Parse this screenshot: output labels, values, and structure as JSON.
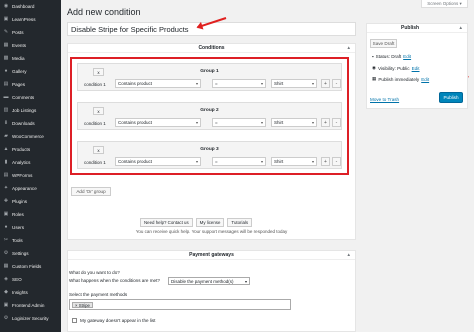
{
  "screen_options": "Screen Options ▾",
  "page_title": "Add new condition",
  "title_value": "Disable Stripe for Specific Products",
  "sidebar": {
    "items": [
      {
        "label": "Dashboard",
        "icon": "dashboard-icon",
        "glyph": "◉"
      },
      {
        "label": "LearnPress",
        "icon": "learnpress-icon",
        "glyph": "▣"
      },
      {
        "label": "Posts",
        "icon": "posts-icon",
        "glyph": "✎"
      },
      {
        "label": "Events",
        "icon": "events-icon",
        "glyph": "▦"
      },
      {
        "label": "Media",
        "icon": "media-icon",
        "glyph": "▩"
      },
      {
        "label": "Gallery",
        "icon": "gallery-icon",
        "glyph": "●"
      },
      {
        "label": "Pages",
        "icon": "pages-icon",
        "glyph": "▤"
      },
      {
        "label": "Comments",
        "icon": "comments-icon",
        "glyph": "▬"
      },
      {
        "label": "Job Listings",
        "icon": "job-listings-icon",
        "glyph": "▥"
      },
      {
        "label": "Downloads",
        "icon": "downloads-icon",
        "glyph": "⬇"
      },
      {
        "label": "WooCommerce",
        "icon": "woocommerce-icon",
        "glyph": "▰"
      },
      {
        "label": "Products",
        "icon": "products-icon",
        "glyph": "▲"
      },
      {
        "label": "Analytics",
        "icon": "analytics-icon",
        "glyph": "▮"
      },
      {
        "label": "WPForms",
        "icon": "wpforms-icon",
        "glyph": "▤"
      },
      {
        "label": "Appearance",
        "icon": "appearance-icon",
        "glyph": "✦"
      },
      {
        "label": "Plugins",
        "icon": "plugins-icon",
        "glyph": "✚"
      },
      {
        "label": "Roles",
        "icon": "roles-icon",
        "glyph": "▣"
      },
      {
        "label": "Users",
        "icon": "users-icon",
        "glyph": "●"
      },
      {
        "label": "Tools",
        "icon": "tools-icon",
        "glyph": "✂"
      },
      {
        "label": "Settings",
        "icon": "settings-icon",
        "glyph": "⚙"
      },
      {
        "label": "Custom Fields",
        "icon": "custom-fields-icon",
        "glyph": "▦"
      },
      {
        "label": "SEO",
        "icon": "seo-icon",
        "glyph": "◈"
      },
      {
        "label": "Insights",
        "icon": "insights-icon",
        "glyph": "◆"
      },
      {
        "label": "Frontend Admin",
        "icon": "frontend-admin-icon",
        "glyph": "▣"
      },
      {
        "label": "Loginizer Security",
        "icon": "loginizer-icon",
        "glyph": "⚙"
      }
    ]
  },
  "conditions_box": {
    "title": "Conditions",
    "toggle": "▲",
    "groups": [
      {
        "remove": "x",
        "title": "Group 1",
        "condition_label": "condition 1",
        "field": "Contains product",
        "operator": "=",
        "value": "Shirt",
        "add": "+",
        "minus": "-"
      },
      {
        "remove": "x",
        "title": "Group 2",
        "condition_label": "condition 1",
        "field": "Contains product",
        "operator": "=",
        "value": "Shirt",
        "add": "+",
        "minus": "-"
      },
      {
        "remove": "x",
        "title": "Group 3",
        "condition_label": "condition 1",
        "field": "Contains product",
        "operator": "=",
        "value": "Shirt",
        "add": "+",
        "minus": "-"
      }
    ],
    "add_or_group": "Add 'Or' group",
    "help_links": [
      "Need help? Contact us",
      "My license",
      "Tutorials"
    ],
    "help_text": "You can receive quick help. Your support messages will be responded today"
  },
  "publish": {
    "title": "Publish",
    "toggle": "▲",
    "save_draft": "Save Draft",
    "status_label": "Status: Draft",
    "status_edit": "Edit",
    "visibility_label": "Visibility: Public",
    "visibility_edit": "Edit",
    "publish_label": "Publish immediately",
    "publish_edit": "Edit",
    "trash": "Move to Trash",
    "publish_button": "Publish"
  },
  "payment_box": {
    "title": "Payment gateways",
    "toggle": "▲",
    "question": "What do you want to do?",
    "happens_label": "What happens when the conditions are met?",
    "happens_value": "Disable the payment method(s)",
    "select_label": "Select the payment methods",
    "selected_method": "× Stripe",
    "checkbox_label": "My gateway doesn't appear in the list"
  },
  "colors": {
    "sidebar_bg": "#23282d",
    "accent": "#0073aa",
    "annotation_red": "#dd1f26",
    "publish_button": "#0085ba"
  }
}
